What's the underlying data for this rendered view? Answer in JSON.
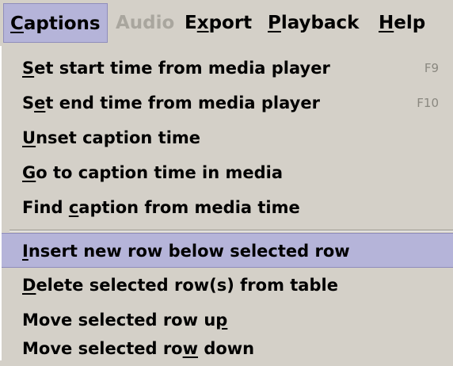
{
  "menubar": {
    "items": [
      {
        "pre": "",
        "u": "C",
        "post": "aptions",
        "state": "active"
      },
      {
        "pre": "Audio",
        "u": "",
        "post": "",
        "state": "disabled"
      },
      {
        "pre": "E",
        "u": "x",
        "post": "port",
        "state": "normal"
      },
      {
        "pre": "",
        "u": "P",
        "post": "layback",
        "state": "normal"
      },
      {
        "pre": "",
        "u": "H",
        "post": "elp",
        "state": "normal"
      }
    ]
  },
  "menu": {
    "items": [
      {
        "pre": "",
        "u": "S",
        "post": "et start time from media player",
        "accel": "F9"
      },
      {
        "pre": "S",
        "u": "e",
        "post": "t end time from media player",
        "accel": "F10"
      },
      {
        "pre": "",
        "u": "U",
        "post": "nset caption time",
        "accel": ""
      },
      {
        "pre": "",
        "u": "G",
        "post": "o to caption time in media",
        "accel": ""
      },
      {
        "pre": "Find ",
        "u": "c",
        "post": "aption from media time",
        "accel": ""
      },
      {
        "pre": "",
        "u": "I",
        "post": "nsert new row below selected row",
        "accel": ""
      },
      {
        "pre": "",
        "u": "D",
        "post": "elete selected row(s) from table",
        "accel": ""
      },
      {
        "pre": "Move selected row u",
        "u": "p",
        "post": "",
        "accel": ""
      },
      {
        "pre": "Move selected ro",
        "u": "w",
        "post": " down",
        "accel": ""
      }
    ]
  }
}
